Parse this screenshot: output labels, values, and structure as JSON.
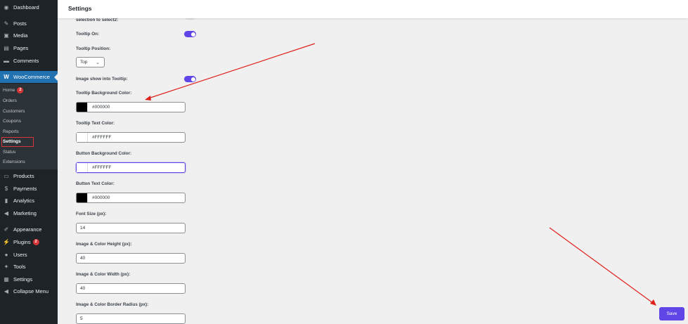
{
  "sidebar": {
    "menu": [
      {
        "label": "Dashboard",
        "icon": "dashboard-icon",
        "glyph": "◉"
      },
      {
        "label": "Posts",
        "icon": "pin-icon",
        "glyph": "✎"
      },
      {
        "label": "Media",
        "icon": "media-icon",
        "glyph": "▣"
      },
      {
        "label": "Pages",
        "icon": "pages-icon",
        "glyph": "▤"
      },
      {
        "label": "Comments",
        "icon": "comments-icon",
        "glyph": "▬"
      },
      {
        "label": "WooCommerce",
        "icon": "woocommerce-icon",
        "glyph": "W"
      },
      {
        "label": "Products",
        "icon": "products-icon",
        "glyph": "▭"
      },
      {
        "label": "Payments",
        "icon": "payments-icon",
        "glyph": "$"
      },
      {
        "label": "Analytics",
        "icon": "analytics-icon",
        "glyph": "▮"
      },
      {
        "label": "Marketing",
        "icon": "marketing-icon",
        "glyph": "◀"
      },
      {
        "label": "Appearance",
        "icon": "appearance-icon",
        "glyph": "✐"
      },
      {
        "label": "Plugins",
        "icon": "plugins-icon",
        "glyph": "⚡",
        "badge": "2"
      },
      {
        "label": "Users",
        "icon": "users-icon",
        "glyph": "●"
      },
      {
        "label": "Tools",
        "icon": "tools-icon",
        "glyph": "✦"
      },
      {
        "label": "Settings",
        "icon": "settings-icon",
        "glyph": "▦"
      },
      {
        "label": "Collapse Menu",
        "icon": "collapse-icon",
        "glyph": "◀"
      }
    ],
    "submenu": [
      {
        "label": "Home",
        "badge": "2"
      },
      {
        "label": "Orders"
      },
      {
        "label": "Customers"
      },
      {
        "label": "Coupons"
      },
      {
        "label": "Reports"
      },
      {
        "label": "Settings"
      },
      {
        "label": "Status"
      },
      {
        "label": "Extensions"
      }
    ]
  },
  "header": {
    "title": "Settings"
  },
  "form": {
    "partial_label": "selection to select2:",
    "tooltip_on": {
      "label": "Tooltip On:",
      "enabled": true
    },
    "tooltip_position": {
      "label": "Tooltip Position:",
      "value": "Top"
    },
    "image_in_tooltip": {
      "label": "Image show into Tooltip:",
      "enabled": true
    },
    "tooltip_bg": {
      "label": "Tooltip Background Color:",
      "value": "#000000",
      "swatch": "#000000"
    },
    "tooltip_text": {
      "label": "Tooltip Text Color:",
      "value": "#FFFFFF",
      "swatch": "#FFFFFF"
    },
    "button_bg": {
      "label": "Button Background Color:",
      "value": "#FFFFFF",
      "swatch": "#FFFFFF"
    },
    "button_text": {
      "label": "Button Text Color:",
      "value": "#000000",
      "swatch": "#000000"
    },
    "font_size": {
      "label": "Font Size (px):",
      "value": "14"
    },
    "img_height": {
      "label": "Image & Color Height (px):",
      "value": "40"
    },
    "img_width": {
      "label": "Image & Color Width (px):",
      "value": "40"
    },
    "img_radius": {
      "label": "Image & Color Border Radius (px):",
      "value": "5"
    }
  },
  "actions": {
    "save_label": "Save"
  },
  "colors": {
    "accent": "#6046e6",
    "sidebar_bg": "#1d2327",
    "active": "#2271b1",
    "arrow": "#e0201c"
  }
}
